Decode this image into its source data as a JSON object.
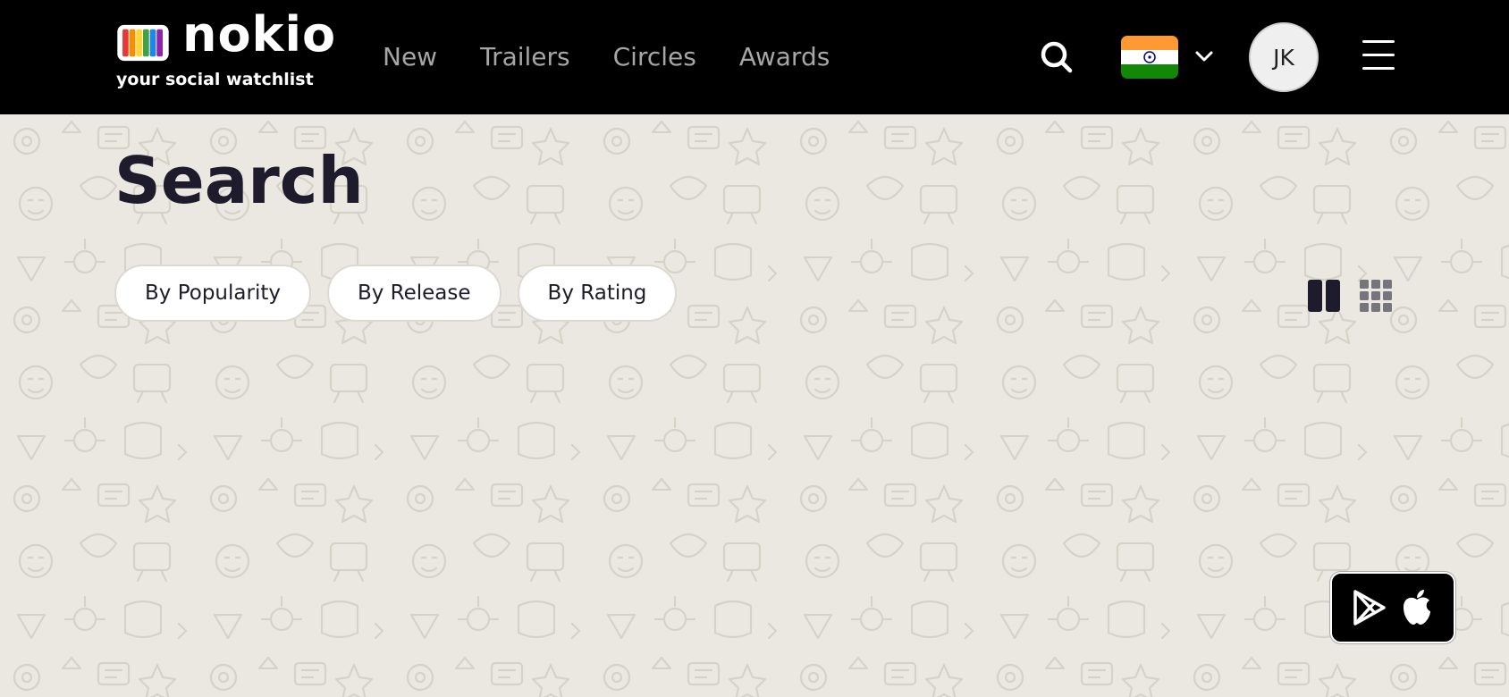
{
  "brand": {
    "name": "nokio",
    "tagline": "your social watchlist"
  },
  "nav": {
    "items": [
      {
        "label": "New"
      },
      {
        "label": "Trailers"
      },
      {
        "label": "Circles"
      },
      {
        "label": "Awards"
      }
    ]
  },
  "header": {
    "search_icon": "search-icon",
    "country_flag": "india-flag",
    "avatar_initials": "JK",
    "menu_icon": "hamburger-menu-icon"
  },
  "page": {
    "title": "Search"
  },
  "sort": {
    "options": [
      {
        "label": "By Popularity"
      },
      {
        "label": "By Release"
      },
      {
        "label": "By Rating"
      }
    ]
  },
  "view_toggle": {
    "options": [
      "two-column-grid-icon",
      "three-by-three-grid-icon"
    ]
  },
  "app_badge": {
    "icons": [
      "google-play-icon",
      "apple-icon"
    ]
  },
  "colors": {
    "header_bg": "#000000",
    "page_bg": "#ebe8e1",
    "title": "#1d1b2c",
    "nav_text": "#a6a6a6",
    "flag_saffron": "#ff9933",
    "flag_green": "#138808"
  }
}
